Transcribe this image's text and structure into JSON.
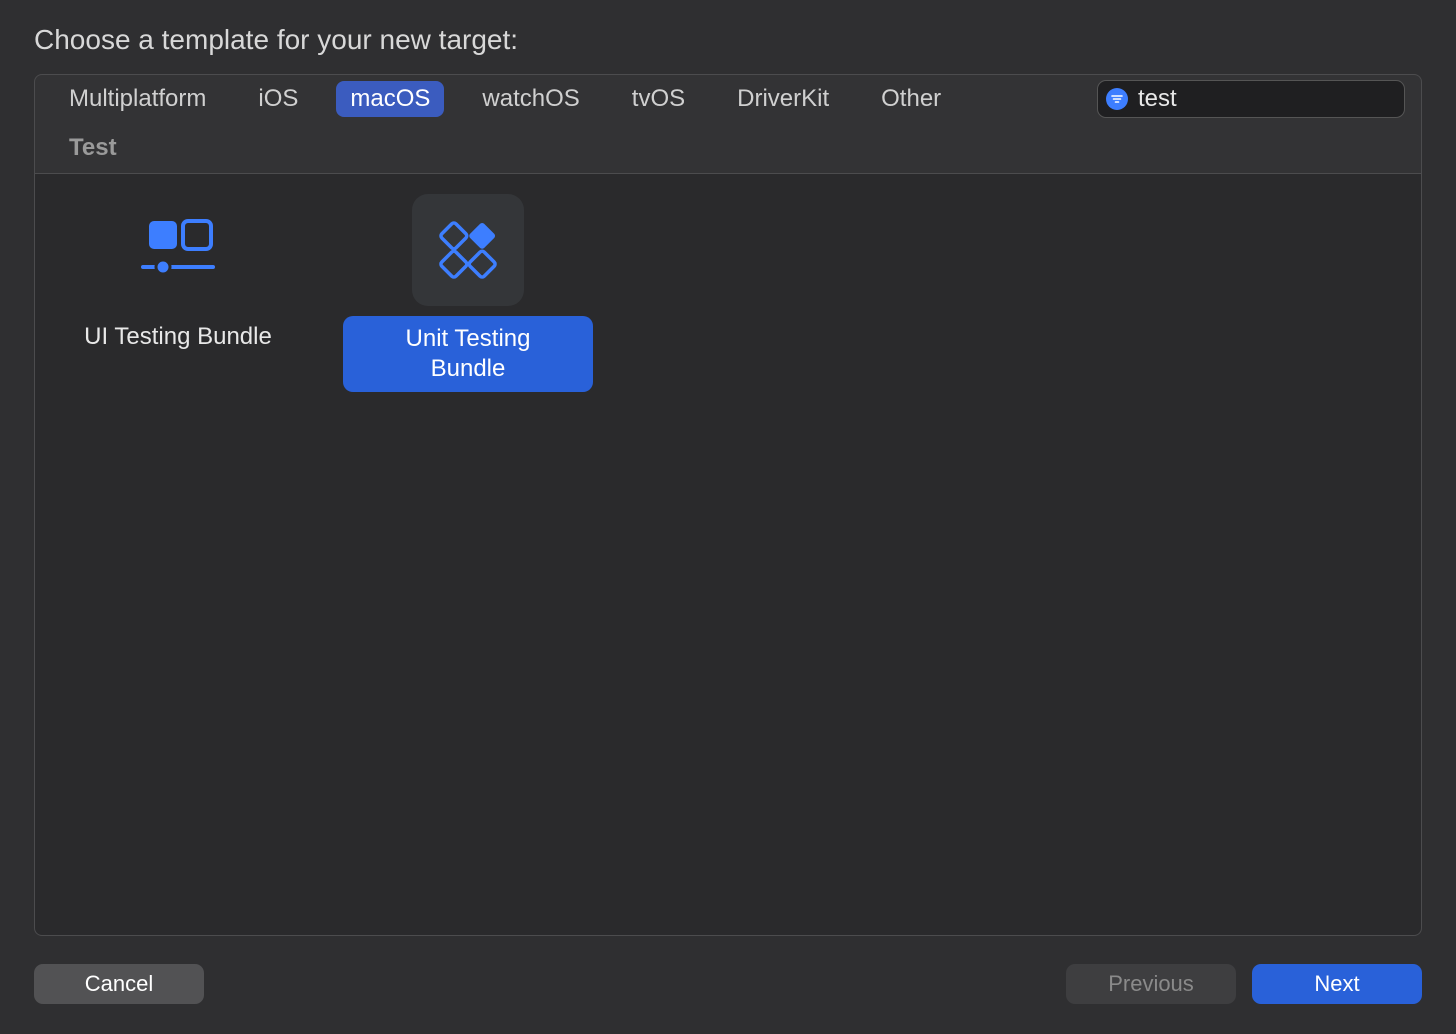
{
  "header": {
    "title": "Choose a template for your new target:"
  },
  "tabs": {
    "items": [
      {
        "label": "Multiplatform",
        "active": false
      },
      {
        "label": "iOS",
        "active": false
      },
      {
        "label": "macOS",
        "active": true
      },
      {
        "label": "watchOS",
        "active": false
      },
      {
        "label": "tvOS",
        "active": false
      },
      {
        "label": "DriverKit",
        "active": false
      },
      {
        "label": "Other",
        "active": false
      }
    ]
  },
  "search": {
    "value": "test",
    "placeholder": "Filter"
  },
  "section": {
    "title": "Test"
  },
  "templates": [
    {
      "label": "UI Testing Bundle",
      "icon": "ui-testing",
      "selected": false
    },
    {
      "label": "Unit Testing Bundle",
      "icon": "unit-testing",
      "selected": true
    }
  ],
  "footer": {
    "cancel": "Cancel",
    "previous": "Previous",
    "next": "Next"
  },
  "colors": {
    "accent": "#2961d9",
    "icon_blue": "#3d7eff"
  }
}
